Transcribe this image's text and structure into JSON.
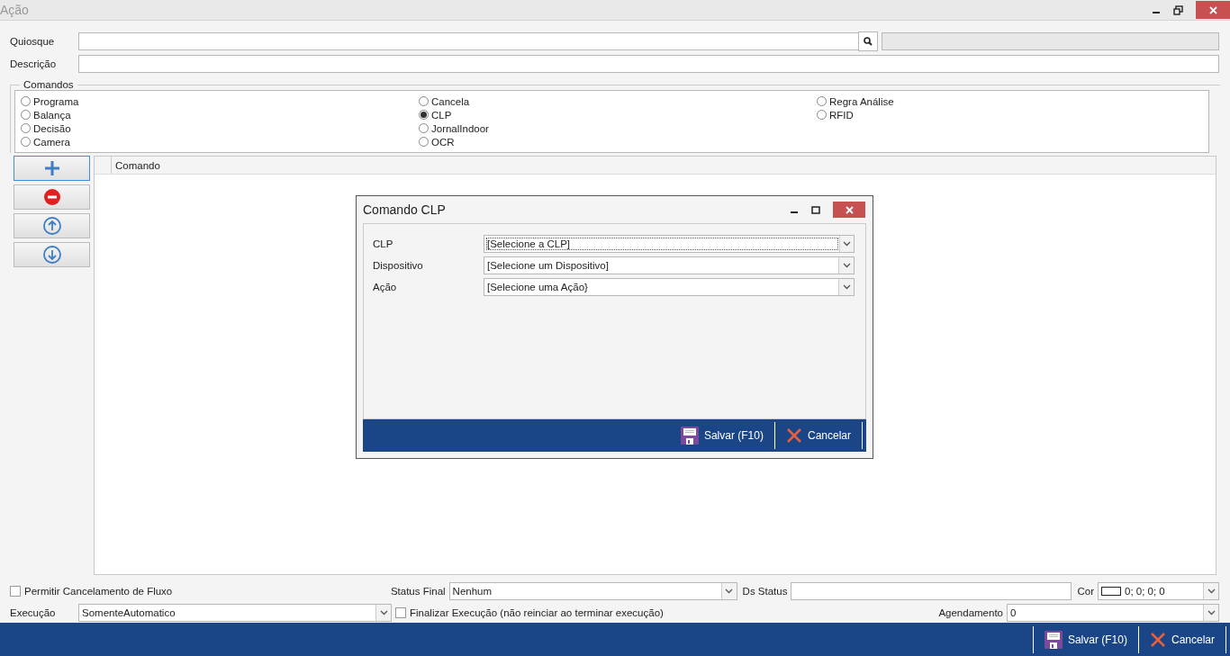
{
  "window": {
    "title": "Ação"
  },
  "form": {
    "quiosque": {
      "label": "Quiosque"
    },
    "descricao": {
      "label": "Descrição"
    }
  },
  "commands": {
    "title": "Comandos",
    "options": [
      {
        "label": "Programa",
        "selected": false
      },
      {
        "label": "Balança",
        "selected": false
      },
      {
        "label": "Decisão",
        "selected": false
      },
      {
        "label": "Camera",
        "selected": false
      },
      {
        "label": "Cancela",
        "selected": false
      },
      {
        "label": "CLP",
        "selected": true
      },
      {
        "label": "JornalIndoor",
        "selected": false
      },
      {
        "label": "OCR",
        "selected": false
      },
      {
        "label": "Regra Análise",
        "selected": false
      },
      {
        "label": "RFID",
        "selected": false
      }
    ]
  },
  "grid": {
    "columns": [
      "Comando"
    ]
  },
  "dialog": {
    "title": "Comando CLP",
    "fields": [
      {
        "label": "CLP",
        "value": "[Selecione a CLP]",
        "focused": true
      },
      {
        "label": "Dispositivo",
        "value": "[Selecione um Dispositivo]",
        "focused": false
      },
      {
        "label": "Ação",
        "value": "[Selecione uma Ação}",
        "focused": false
      }
    ],
    "buttons": [
      {
        "kind": "save",
        "label": "Salvar (F10)"
      },
      {
        "kind": "cancel",
        "label": "Cancelar"
      }
    ]
  },
  "bottom": {
    "permitir": {
      "label": "Permitir Cancelamento de Fluxo",
      "checked": false
    },
    "status_final": {
      "label": "Status Final",
      "value": "Nenhum"
    },
    "ds_status": {
      "label": "Ds Status"
    },
    "cor": {
      "label": "Cor",
      "value": "0; 0; 0; 0"
    },
    "execucao": {
      "label": "Execução",
      "value": "SomenteAutomatico"
    },
    "finalizar": {
      "label": "Finalizar Execução (não reinciar ao terminar execução)",
      "checked": false
    },
    "agendamento": {
      "label": "Agendamento",
      "value": "0"
    }
  },
  "footer": {
    "buttons": [
      {
        "kind": "save",
        "label": "Salvar (F10)"
      },
      {
        "kind": "cancel",
        "label": "Cancelar"
      }
    ]
  }
}
